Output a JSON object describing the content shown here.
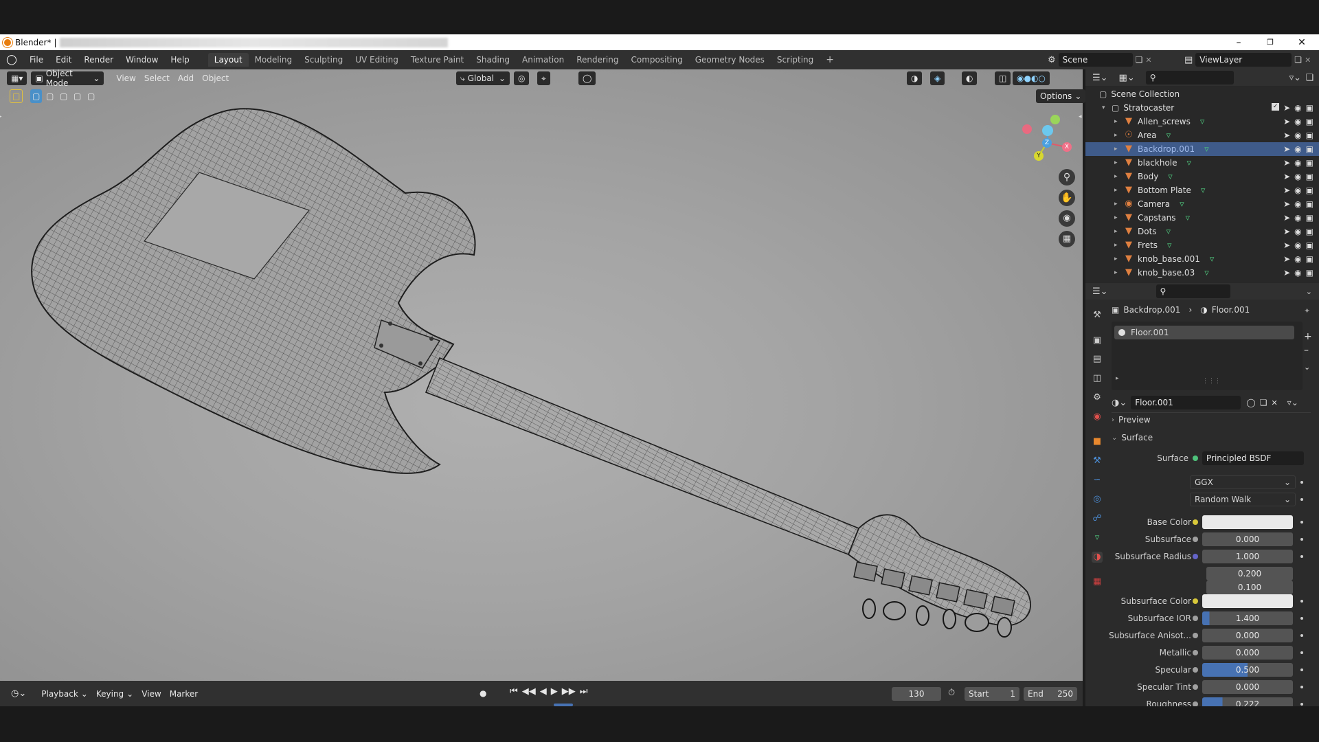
{
  "window": {
    "app_title": "Blender*",
    "separator": "|"
  },
  "menubar": {
    "menus": [
      "File",
      "Edit",
      "Render",
      "Window",
      "Help"
    ],
    "workspaces": [
      "Layout",
      "Modeling",
      "Sculpting",
      "UV Editing",
      "Texture Paint",
      "Shading",
      "Animation",
      "Rendering",
      "Compositing",
      "Geometry Nodes",
      "Scripting"
    ],
    "add_tab": "+",
    "scene": "Scene",
    "view_layer": "ViewLayer"
  },
  "viewport_header": {
    "mode": "Object Mode",
    "view": "View",
    "select": "Select",
    "add": "Add",
    "object": "Object",
    "orientation": "Global",
    "options": "Options"
  },
  "gizmo": {
    "x": "X",
    "y": "Y",
    "z": "Z"
  },
  "outliner": {
    "scene_collection": "Scene Collection",
    "collection": "Stratocaster",
    "items": [
      {
        "name": "Allen_screws",
        "selected": false,
        "icon": "mesh-icon"
      },
      {
        "name": "Area",
        "selected": false,
        "icon": "light-icon"
      },
      {
        "name": "Backdrop.001",
        "selected": true,
        "icon": "mesh-icon"
      },
      {
        "name": "blackhole",
        "selected": false,
        "icon": "mesh-icon"
      },
      {
        "name": "Body",
        "selected": false,
        "icon": "mesh-icon"
      },
      {
        "name": "Bottom Plate",
        "selected": false,
        "icon": "mesh-icon"
      },
      {
        "name": "Camera",
        "selected": false,
        "icon": "camera-icon"
      },
      {
        "name": "Capstans",
        "selected": false,
        "icon": "mesh-icon"
      },
      {
        "name": "Dots",
        "selected": false,
        "icon": "mesh-icon"
      },
      {
        "name": "Frets",
        "selected": false,
        "icon": "mesh-icon"
      },
      {
        "name": "knob_base.001",
        "selected": false,
        "icon": "mesh-icon"
      },
      {
        "name": "knob_base.03",
        "selected": false,
        "icon": "mesh-icon"
      }
    ]
  },
  "properties": {
    "breadcrumb_object": "Backdrop.001",
    "breadcrumb_material": "Floor.001",
    "slot": "Floor.001",
    "material_name": "Floor.001",
    "preview_label": "Preview",
    "surface_section": "Surface",
    "surface_label": "Surface",
    "surface_shader": "Principled BSDF",
    "distribution": "GGX",
    "subsurface_method": "Random Walk",
    "fields": [
      {
        "label": "Base Color",
        "value": "",
        "kind": "color",
        "dot": "#d8c83a"
      },
      {
        "label": "Subsurface",
        "value": "0.000",
        "kind": "num",
        "dot": "#a0a0a0"
      },
      {
        "label": "Subsurface Radius",
        "value": "1.000",
        "kind": "num",
        "dot": "#6464c8"
      },
      {
        "label": "",
        "value": "0.200",
        "kind": "num",
        "dot": ""
      },
      {
        "label": "",
        "value": "0.100",
        "kind": "num",
        "dot": ""
      },
      {
        "label": "Subsurface Color",
        "value": "",
        "kind": "color",
        "dot": "#d8c83a"
      },
      {
        "label": "Subsurface IOR",
        "value": "1.400",
        "kind": "num",
        "dot": "#a0a0a0",
        "fill": 0.08
      },
      {
        "label": "Subsurface Anisot...",
        "value": "0.000",
        "kind": "num",
        "dot": "#a0a0a0"
      },
      {
        "label": "Metallic",
        "value": "0.000",
        "kind": "num",
        "dot": "#a0a0a0"
      },
      {
        "label": "Specular",
        "value": "0.500",
        "kind": "num",
        "dot": "#a0a0a0",
        "fill": 0.5
      },
      {
        "label": "Specular Tint",
        "value": "0.000",
        "kind": "num",
        "dot": "#a0a0a0"
      },
      {
        "label": "Roughness",
        "value": "0.222",
        "kind": "num",
        "dot": "#a0a0a0",
        "fill": 0.222
      }
    ]
  },
  "timeline": {
    "playback": "Playback",
    "keying": "Keying",
    "view": "View",
    "marker": "Marker",
    "current_frame": "130",
    "start_label": "Start",
    "start": "1",
    "end_label": "End",
    "end": "250"
  },
  "colors": {
    "selection": "#3f5b8a",
    "accent": "#4772b3",
    "viewport": "#a4a4a4"
  }
}
